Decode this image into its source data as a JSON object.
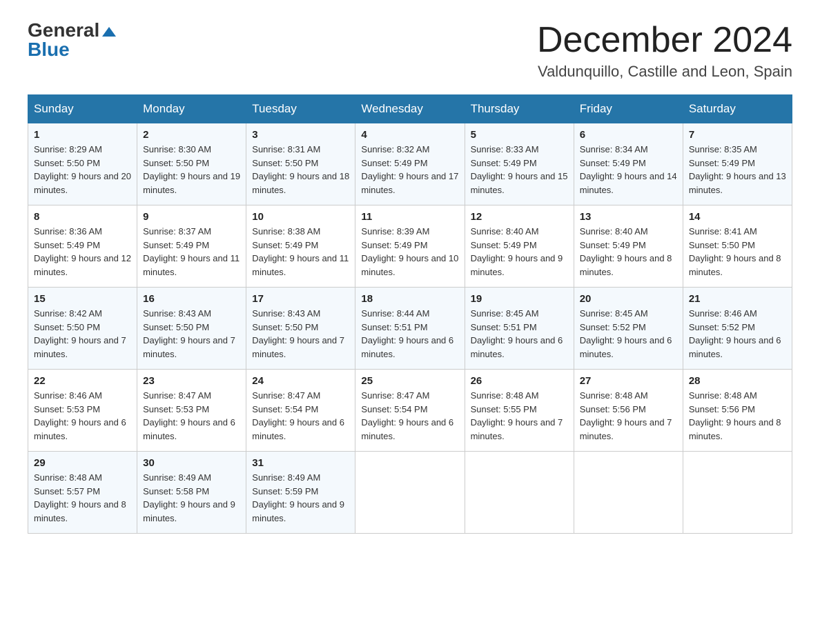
{
  "header": {
    "logo_general": "General",
    "logo_blue": "Blue",
    "month_title": "December 2024",
    "location": "Valdunquillo, Castille and Leon, Spain"
  },
  "days_of_week": [
    "Sunday",
    "Monday",
    "Tuesday",
    "Wednesday",
    "Thursday",
    "Friday",
    "Saturday"
  ],
  "weeks": [
    [
      {
        "day": "1",
        "sunrise": "8:29 AM",
        "sunset": "5:50 PM",
        "daylight": "9 hours and 20 minutes."
      },
      {
        "day": "2",
        "sunrise": "8:30 AM",
        "sunset": "5:50 PM",
        "daylight": "9 hours and 19 minutes."
      },
      {
        "day": "3",
        "sunrise": "8:31 AM",
        "sunset": "5:50 PM",
        "daylight": "9 hours and 18 minutes."
      },
      {
        "day": "4",
        "sunrise": "8:32 AM",
        "sunset": "5:49 PM",
        "daylight": "9 hours and 17 minutes."
      },
      {
        "day": "5",
        "sunrise": "8:33 AM",
        "sunset": "5:49 PM",
        "daylight": "9 hours and 15 minutes."
      },
      {
        "day": "6",
        "sunrise": "8:34 AM",
        "sunset": "5:49 PM",
        "daylight": "9 hours and 14 minutes."
      },
      {
        "day": "7",
        "sunrise": "8:35 AM",
        "sunset": "5:49 PM",
        "daylight": "9 hours and 13 minutes."
      }
    ],
    [
      {
        "day": "8",
        "sunrise": "8:36 AM",
        "sunset": "5:49 PM",
        "daylight": "9 hours and 12 minutes."
      },
      {
        "day": "9",
        "sunrise": "8:37 AM",
        "sunset": "5:49 PM",
        "daylight": "9 hours and 11 minutes."
      },
      {
        "day": "10",
        "sunrise": "8:38 AM",
        "sunset": "5:49 PM",
        "daylight": "9 hours and 11 minutes."
      },
      {
        "day": "11",
        "sunrise": "8:39 AM",
        "sunset": "5:49 PM",
        "daylight": "9 hours and 10 minutes."
      },
      {
        "day": "12",
        "sunrise": "8:40 AM",
        "sunset": "5:49 PM",
        "daylight": "9 hours and 9 minutes."
      },
      {
        "day": "13",
        "sunrise": "8:40 AM",
        "sunset": "5:49 PM",
        "daylight": "9 hours and 8 minutes."
      },
      {
        "day": "14",
        "sunrise": "8:41 AM",
        "sunset": "5:50 PM",
        "daylight": "9 hours and 8 minutes."
      }
    ],
    [
      {
        "day": "15",
        "sunrise": "8:42 AM",
        "sunset": "5:50 PM",
        "daylight": "9 hours and 7 minutes."
      },
      {
        "day": "16",
        "sunrise": "8:43 AM",
        "sunset": "5:50 PM",
        "daylight": "9 hours and 7 minutes."
      },
      {
        "day": "17",
        "sunrise": "8:43 AM",
        "sunset": "5:50 PM",
        "daylight": "9 hours and 7 minutes."
      },
      {
        "day": "18",
        "sunrise": "8:44 AM",
        "sunset": "5:51 PM",
        "daylight": "9 hours and 6 minutes."
      },
      {
        "day": "19",
        "sunrise": "8:45 AM",
        "sunset": "5:51 PM",
        "daylight": "9 hours and 6 minutes."
      },
      {
        "day": "20",
        "sunrise": "8:45 AM",
        "sunset": "5:52 PM",
        "daylight": "9 hours and 6 minutes."
      },
      {
        "day": "21",
        "sunrise": "8:46 AM",
        "sunset": "5:52 PM",
        "daylight": "9 hours and 6 minutes."
      }
    ],
    [
      {
        "day": "22",
        "sunrise": "8:46 AM",
        "sunset": "5:53 PM",
        "daylight": "9 hours and 6 minutes."
      },
      {
        "day": "23",
        "sunrise": "8:47 AM",
        "sunset": "5:53 PM",
        "daylight": "9 hours and 6 minutes."
      },
      {
        "day": "24",
        "sunrise": "8:47 AM",
        "sunset": "5:54 PM",
        "daylight": "9 hours and 6 minutes."
      },
      {
        "day": "25",
        "sunrise": "8:47 AM",
        "sunset": "5:54 PM",
        "daylight": "9 hours and 6 minutes."
      },
      {
        "day": "26",
        "sunrise": "8:48 AM",
        "sunset": "5:55 PM",
        "daylight": "9 hours and 7 minutes."
      },
      {
        "day": "27",
        "sunrise": "8:48 AM",
        "sunset": "5:56 PM",
        "daylight": "9 hours and 7 minutes."
      },
      {
        "day": "28",
        "sunrise": "8:48 AM",
        "sunset": "5:56 PM",
        "daylight": "9 hours and 8 minutes."
      }
    ],
    [
      {
        "day": "29",
        "sunrise": "8:48 AM",
        "sunset": "5:57 PM",
        "daylight": "9 hours and 8 minutes."
      },
      {
        "day": "30",
        "sunrise": "8:49 AM",
        "sunset": "5:58 PM",
        "daylight": "9 hours and 9 minutes."
      },
      {
        "day": "31",
        "sunrise": "8:49 AM",
        "sunset": "5:59 PM",
        "daylight": "9 hours and 9 minutes."
      },
      null,
      null,
      null,
      null
    ]
  ]
}
